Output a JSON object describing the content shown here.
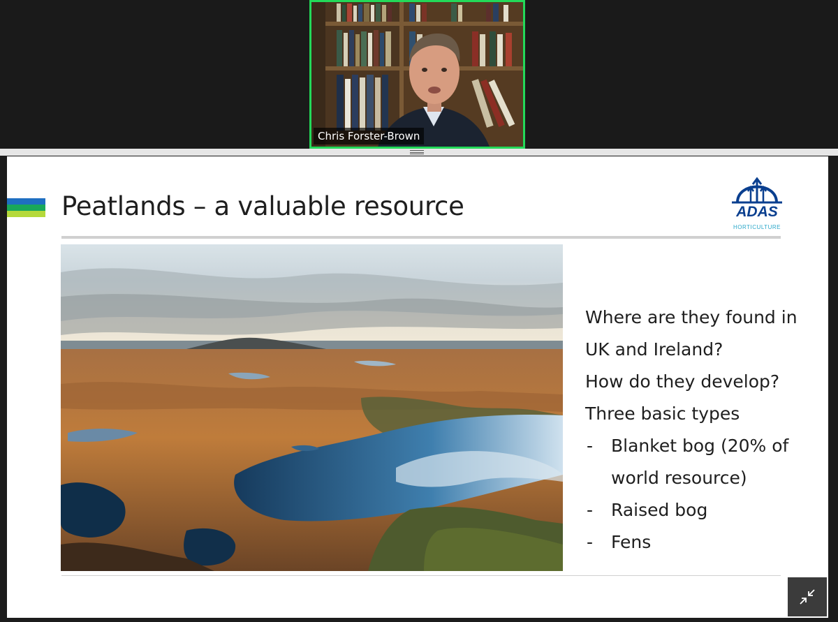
{
  "participant": {
    "name": "Chris Forster-Brown"
  },
  "slide": {
    "title": "Peatlands – a valuable resource",
    "logo": {
      "name": "ADAS",
      "subtitle": "HORTICULTURE"
    },
    "accent_colors": [
      "#1f6fc1",
      "#19a85a",
      "#b5d93b"
    ],
    "bullets": [
      {
        "text": "Where are they found in",
        "sub": false
      },
      {
        "text": "UK and Ireland?",
        "sub": false
      },
      {
        "text": "How do they develop?",
        "sub": false
      },
      {
        "text": "Three basic types",
        "sub": false
      },
      {
        "dash": "-",
        "text": "Blanket bog (20% of",
        "sub": true
      },
      {
        "dash": "",
        "text": "world resource)",
        "sub": true
      },
      {
        "dash": "-",
        "text": "Raised bog",
        "sub": true
      },
      {
        "dash": "-",
        "text": "Fens",
        "sub": true
      }
    ]
  },
  "controls": {
    "exit_fullscreen_icon": "collapse-arrows-icon"
  }
}
